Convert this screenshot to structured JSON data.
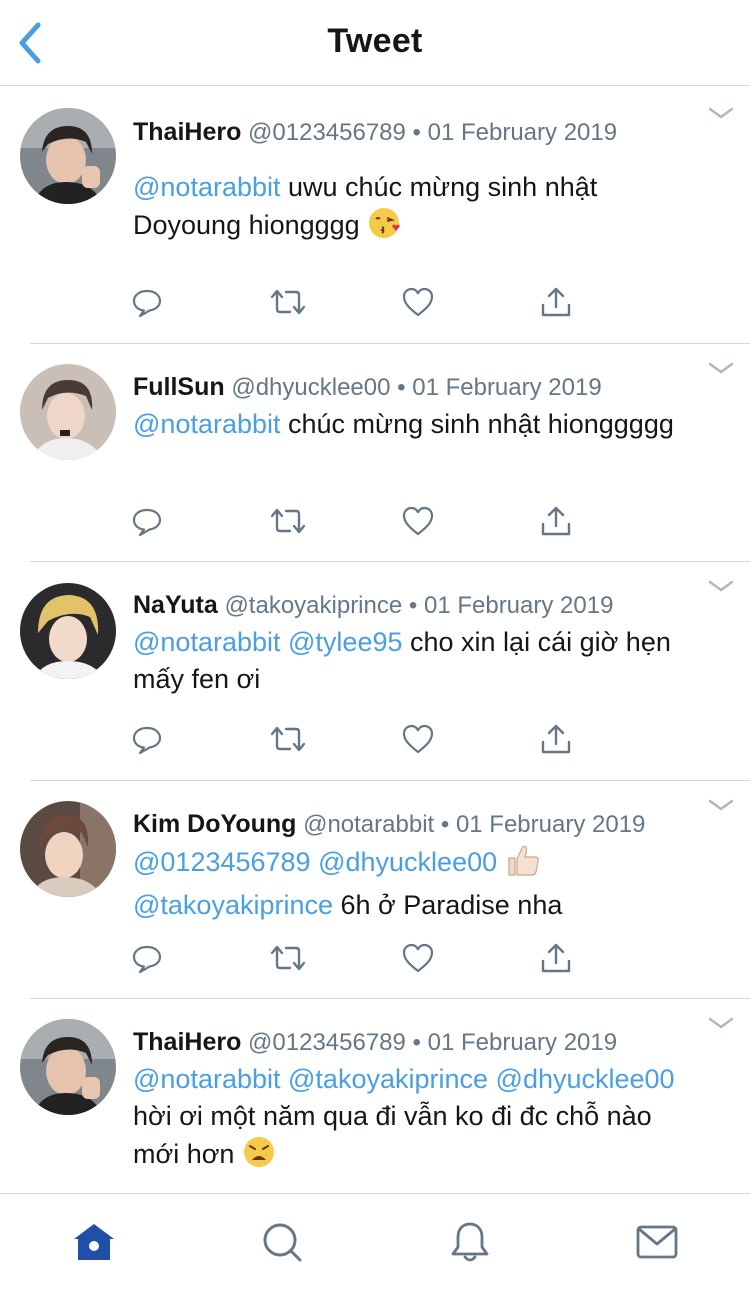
{
  "header": {
    "title": "Tweet"
  },
  "colors": {
    "accent": "#4a9fe3",
    "text": "#14171a",
    "muted": "#657786",
    "divider": "#d5d9dc",
    "tab_active": "#1f4fa8"
  },
  "tweets": [
    {
      "name": "ThaiHero",
      "handle": "@0123456789",
      "separator": "•",
      "date": "01 February 2019",
      "body": [
        {
          "type": "mention",
          "text": "@notarabbit"
        },
        {
          "type": "text",
          "text": " uwu chúc mừng sinh nhật Doyoung hiongggg "
        },
        {
          "type": "emoji",
          "icon": "kissing-face-emoji"
        }
      ]
    },
    {
      "name": "FullSun",
      "handle": "@dhyucklee00",
      "separator": "•",
      "date": "01 February 2019",
      "body": [
        {
          "type": "mention",
          "text": "@notarabbit"
        },
        {
          "type": "text",
          "text": " chúc mừng sinh nhật hionggggg"
        }
      ]
    },
    {
      "name": "NaYuta",
      "handle": "@takoyakiprince",
      "separator": "•",
      "date": "01 February 2019",
      "body": [
        {
          "type": "mention",
          "text": "@notarabbit"
        },
        {
          "type": "text",
          "text": " "
        },
        {
          "type": "mention",
          "text": "@tylee95"
        },
        {
          "type": "text",
          "text": " cho xin lại cái giờ hẹn mấy fen ơi"
        }
      ]
    },
    {
      "name": "Kim DoYoung",
      "handle": "@notarabbit",
      "separator": "•",
      "date": "01 February 2019",
      "body": [
        {
          "type": "mention",
          "text": "@0123456789"
        },
        {
          "type": "text",
          "text": " "
        },
        {
          "type": "mention",
          "text": "@dhyucklee00"
        },
        {
          "type": "text",
          "text": " "
        },
        {
          "type": "emoji",
          "icon": "thumbs-up-emoji"
        },
        {
          "type": "text",
          "text": " "
        },
        {
          "type": "mention",
          "text": "@takoyakiprince"
        },
        {
          "type": "text",
          "text": " 6h ở Paradise nha"
        }
      ]
    },
    {
      "name": "ThaiHero",
      "handle": "@0123456789",
      "separator": "•",
      "date": "01 February 2019",
      "body": [
        {
          "type": "mention",
          "text": "@notarabbit"
        },
        {
          "type": "text",
          "text": " "
        },
        {
          "type": "mention",
          "text": "@takoyakiprince"
        },
        {
          "type": "text",
          "text": " "
        },
        {
          "type": "mention",
          "text": "@dhyucklee00"
        },
        {
          "type": "text",
          "text": " hời ơi một năm qua đi vẫn ko đi đc chỗ nào mới hơn "
        },
        {
          "type": "emoji",
          "icon": "weary-face-emoji"
        }
      ]
    }
  ],
  "tabbar": {
    "items": [
      {
        "icon": "home-icon",
        "active": true
      },
      {
        "icon": "search-icon",
        "active": false
      },
      {
        "icon": "bell-icon",
        "active": false
      },
      {
        "icon": "mail-icon",
        "active": false
      }
    ]
  }
}
